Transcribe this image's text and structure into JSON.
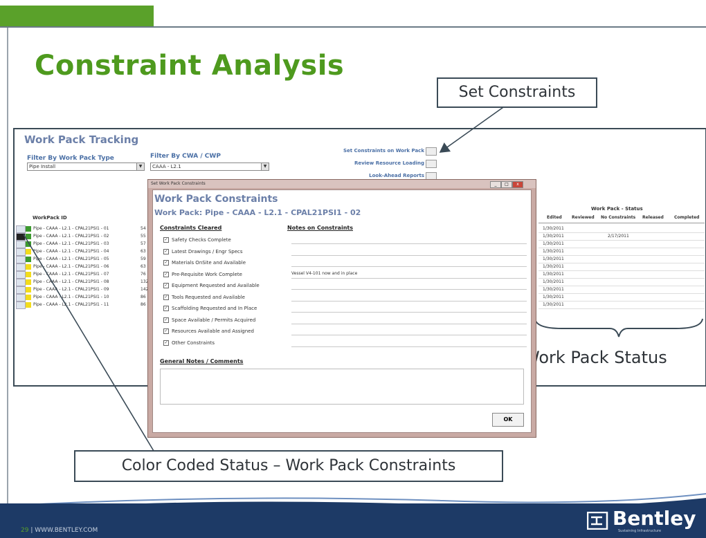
{
  "slide": {
    "title": "Constraint Analysis",
    "callouts": {
      "set_constraints": "Set Constraints",
      "work_pack_status": "Work Pack Status",
      "color_coded": "Color Coded Status – Work Pack Constraints"
    },
    "footer": {
      "page_number": "29",
      "url": "| WWW.BENTLEY.COM",
      "brand": "Bentley",
      "tagline": "Sustaining Infrastructure"
    },
    "colors": {
      "accent_green": "#5aa12a",
      "title_green": "#4e9a1e",
      "footer_navy": "#1d3a66"
    }
  },
  "app": {
    "title": "Work Pack Tracking",
    "filter_type": {
      "label": "Filter By Work Pack Type",
      "value": "Pipe Install"
    },
    "filter_cwa": {
      "label": "Filter By CWA / CWP",
      "value": "CAAA - L2.1"
    },
    "links": [
      "Set Constraints on Work Pack",
      "Review Resource Loading",
      "Look-Ahead Reports"
    ],
    "workpack_header": "WorkPack ID",
    "rows": [
      {
        "id": "Pipe - CAAA - L2.1 - CPAL21PSI1 - 01",
        "num": "54",
        "color": "#3c9a2e"
      },
      {
        "id": "Pipe - CAAA - L2.1 - CPAL21PSI1 - 02",
        "num": "55",
        "color": "#3c9a2e"
      },
      {
        "id": "Pipe - CAAA - L2.1 - CPAL21PSI1 - 03",
        "num": "57",
        "color": "#3c9a2e"
      },
      {
        "id": "Pipe - CAAA - L2.1 - CPAL21PSI1 - 04",
        "num": "63",
        "color": "#f2dc1c"
      },
      {
        "id": "Pipe - CAAA - L2.1 - CPAL21PSI1 - 05",
        "num": "59",
        "color": "#3c9a2e"
      },
      {
        "id": "Pipe - CAAA - L2.1 - CPAL21PSI1 - 06",
        "num": "63",
        "color": "#f2dc1c"
      },
      {
        "id": "Pipe - CAAA - L2.1 - CPAL21PSI1 - 07",
        "num": "76",
        "color": "#f2dc1c"
      },
      {
        "id": "Pipe - CAAA - L2.1 - CPAL21PSI1 - 08",
        "num": "132",
        "color": "#f2dc1c"
      },
      {
        "id": "Pipe - CAAA - L2.1 - CPAL21PSI1 - 09",
        "num": "142",
        "color": "#f2dc1c"
      },
      {
        "id": "Pipe - CAAA - L2.1 - CPAL21PSI1 - 10",
        "num": "86",
        "color": "#f2dc1c"
      },
      {
        "id": "Pipe - CAAA - L2.1 - CPAL21PSI1 - 11",
        "num": "86",
        "color": "#f2dc1c"
      }
    ],
    "status": {
      "group_header": "Work Pack - Status",
      "columns": [
        "Edited",
        "Reviewed",
        "No Constraints",
        "Released",
        "Completed"
      ],
      "edited_dates": [
        "1/30/2011",
        "1/30/2011",
        "1/30/2011",
        "1/30/2011",
        "1/30/2011",
        "1/30/2011",
        "1/30/2011",
        "1/30/2011",
        "1/30/2011",
        "1/30/2011",
        "1/30/2011"
      ],
      "no_constraints_row2": "2/17/2011"
    }
  },
  "dialog": {
    "window_title": "Set Work Pack Constraints",
    "title": "Work Pack Constraints",
    "subtitle": "Work Pack:  Pipe - CAAA - L2.1 - CPAL21PSI1 - 02",
    "col_cleared": "Constraints Cleared",
    "col_notes": "Notes on Constraints",
    "constraints": [
      "Safety Checks Complete",
      "Latest Drawings / Engr Specs",
      "Materials OnSite and Available",
      "Pre-Requisite Work Complete",
      "Equipment Requested and Available",
      "Tools Requested and Available",
      "Scaffolding Requested and In Place",
      "Space Available / Permits Acquired",
      "Resources Available and Assigned",
      "Other Constraints"
    ],
    "note_row4": "Vessel V4-101 now  and in place",
    "general_notes_label": "General Notes / Comments",
    "ok_label": "OK"
  }
}
